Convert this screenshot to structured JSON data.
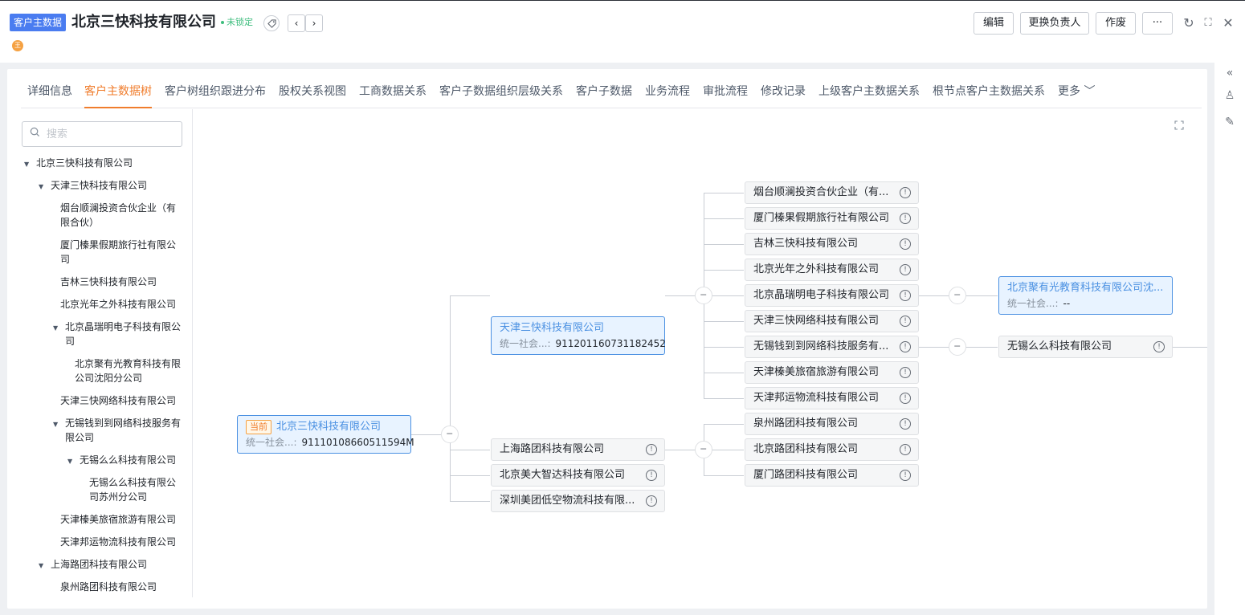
{
  "header": {
    "module_tag": "客户主数据",
    "title": "北京三快科技有限公司",
    "lock_status": "未锁定",
    "tag_icon": "tag-icon",
    "prev": "‹",
    "next": "›",
    "avatar_letter": "王",
    "buttons": {
      "edit": "编辑",
      "change_owner": "更换负责人",
      "void": "作废",
      "more": "···"
    },
    "icons": {
      "refresh": "↻",
      "expand": "⛶",
      "close": "✕"
    }
  },
  "right_rail": {
    "collapse": "«",
    "team": "♙",
    "note": "✎"
  },
  "tabs": [
    "详细信息",
    "客户主数据树",
    "客户树组织跟进分布",
    "股权关系视图",
    "工商数据关系",
    "客户子数据组织层级关系",
    "客户子数据",
    "业务流程",
    "审批流程",
    "修改记录",
    "上级客户主数据关系",
    "根节点客户主数据关系",
    "更多 ﹀"
  ],
  "search": {
    "placeholder": "搜索",
    "value": ""
  },
  "tree": [
    "北京三快科技有限公司",
    "天津三快科技有限公司",
    "烟台顺澜投资合伙企业（有限合伙）",
    "厦门榛果假期旅行社有限公司",
    "吉林三快科技有限公司",
    "北京光年之外科技有限公司",
    "北京晶瑞明电子科技有限公司",
    "北京聚有光教育科技有限公司沈阳分公司",
    "天津三快网络科技有限公司",
    "无锡钱到到网络科技服务有限公司",
    "无锡么么科技有限公司",
    "无锡么么科技有限公司苏州分公司",
    "天津榛美旅宿旅游有限公司",
    "天津邦运物流科技有限公司",
    "上海路团科技有限公司",
    "泉州路团科技有限公司"
  ],
  "graph": {
    "current_tag": "当前",
    "credit_label": "统一社会...:",
    "root": {
      "name": "北京三快科技有限公司",
      "credit": "91110108660511594M"
    },
    "tianjin": {
      "name": "天津三快科技有限公司",
      "credit": "911201160731182452"
    },
    "tianjin_children": [
      "烟台顺澜投资合伙企业（有...",
      "厦门榛果假期旅行社有限公司",
      "吉林三快科技有限公司",
      "北京光年之外科技有限公司",
      "北京晶瑞明电子科技有限公司",
      "天津三快网络科技有限公司",
      "无锡钱到到网络科技服务有...",
      "天津榛美旅宿旅游有限公司",
      "天津邦运物流科技有限公司"
    ],
    "jingrui_child": {
      "name": "北京聚有光教育科技有限公司沈...",
      "credit": "--"
    },
    "wuxi_child": "无锡么么科技有限公司",
    "root_children": [
      "上海路团科技有限公司",
      "北京美大智达科技有限公司",
      "深圳美团低空物流科技有限..."
    ],
    "shanghai_children": [
      "泉州路团科技有限公司",
      "北京路团科技有限公司",
      "厦门路团科技有限公司"
    ],
    "collapse_symbol": "−",
    "info_symbol": "!"
  }
}
